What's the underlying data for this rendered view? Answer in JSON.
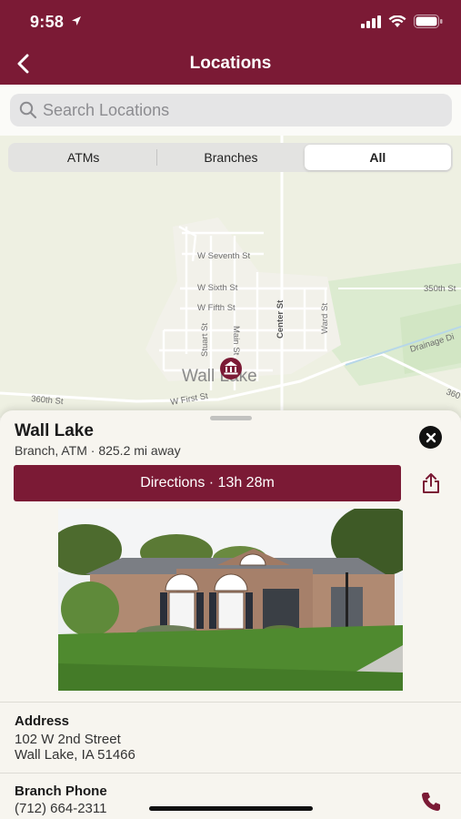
{
  "status": {
    "time": "9:58"
  },
  "nav": {
    "title": "Locations"
  },
  "search": {
    "placeholder": "Search Locations"
  },
  "filter": {
    "options": [
      "ATMs",
      "Branches",
      "All"
    ],
    "selected": "All"
  },
  "map": {
    "streets": [
      "W Seventh St",
      "W Sixth St",
      "W Fifth St",
      "Stuart St",
      "Main St",
      "Center St",
      "Ward St",
      "W First St",
      "360th St",
      "350th St",
      "Drainage Di",
      "360"
    ],
    "place_label": "Wall Lake"
  },
  "location": {
    "name": "Wall Lake",
    "subtitle": "Branch, ATM · 825.2 mi away",
    "directions_label": "Directions · 13h 28m",
    "address_label": "Address",
    "address_line1": "102 W 2nd Street",
    "address_line2": "Wall Lake, IA 51466",
    "phone_label": "Branch Phone",
    "phone": "(712) 664-2311"
  },
  "colors": {
    "brand": "#7b1a35"
  },
  "icons": [
    "location-arrow-icon",
    "signal-icon",
    "wifi-icon",
    "battery-icon",
    "back-chevron-icon",
    "search-icon",
    "bank-marker-icon",
    "close-icon",
    "share-icon",
    "phone-icon"
  ]
}
